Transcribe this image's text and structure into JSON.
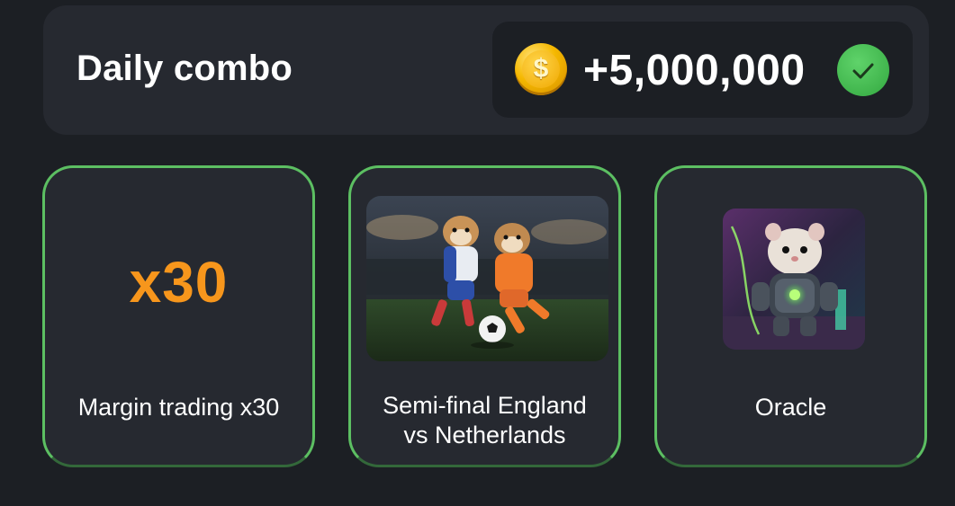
{
  "header": {
    "title": "Daily combo",
    "reward_amount": "+5,000,000",
    "coin_symbol": "$"
  },
  "cards": [
    {
      "badge_text": "x30",
      "label": "Margin trading x30",
      "image": "x30-text-icon"
    },
    {
      "label_line1": "Semi-final England",
      "label_line2": "vs Netherlands",
      "image": "hamsters-football-picture"
    },
    {
      "label": "Oracle",
      "image": "robot-hamster-picture"
    }
  ],
  "colors": {
    "background": "#1c1f24",
    "panel": "#262930",
    "card_border": "#5cbf62",
    "accent_orange": "#f7961c",
    "check_green": "#3fb84c",
    "coin_gold": "#f5b800"
  }
}
